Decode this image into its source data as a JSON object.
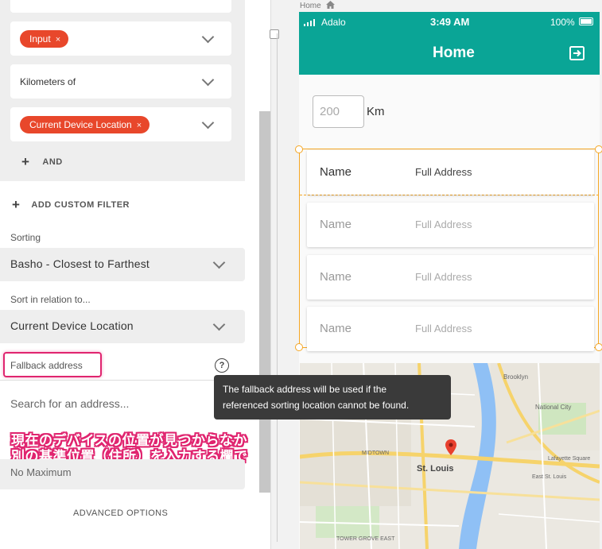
{
  "filters": {
    "chip_input": "Input",
    "distance_label": "Kilometers of",
    "chip_location": "Current Device Location",
    "and_label": "AND",
    "add_custom_filter": "ADD CUSTOM FILTER",
    "chip_remove_symbol": "×"
  },
  "sorting": {
    "label": "Sorting",
    "value": "Basho - Closest to Farthest",
    "relation_label": "Sort in relation to...",
    "relation_value": "Current Device Location",
    "fallback_label": "Fallback address",
    "help_symbol": "?",
    "search_placeholder": "Search for an address..."
  },
  "max": {
    "value": "No Maximum"
  },
  "advanced_options": "ADVANCED OPTIONS",
  "annotation": {
    "line1": "現在のデバイスの位置が見つからなかった場合に",
    "line2": "別の基準位置（住所）を入力する欄です"
  },
  "tooltip": {
    "line1": "The fallback address will be used if the",
    "line2": "referenced sorting location cannot be found."
  },
  "canvas": {
    "screen_label": "Home"
  },
  "phone": {
    "carrier": "Adalo",
    "time": "3:49 AM",
    "battery": "100%",
    "title": "Home",
    "distance_input": "200",
    "distance_unit": "Km",
    "list": [
      {
        "name": "Name",
        "address": "Full Address"
      },
      {
        "name": "Name",
        "address": "Full Address"
      },
      {
        "name": "Name",
        "address": "Full Address"
      },
      {
        "name": "Name",
        "address": "Full Address"
      }
    ]
  },
  "map": {
    "city": "St. Louis",
    "labels": [
      "Brooklyn",
      "National City",
      "Lafayette Square",
      "MIDTOWN",
      "East St. Louis",
      "TOWER GROVE EAST"
    ]
  },
  "colors": {
    "accent": "#0aa596",
    "chip": "#e8472b",
    "highlight": "#e0246f",
    "selection": "#f5a623"
  }
}
